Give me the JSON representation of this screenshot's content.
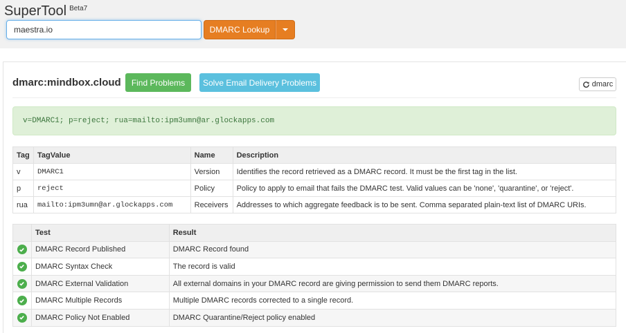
{
  "app": {
    "name": "SuperTool",
    "badge": "Beta7"
  },
  "search": {
    "value": "maestra.io",
    "lookup_label": "DMARC Lookup"
  },
  "result": {
    "title": "dmarc:mindbox.cloud",
    "find_problems_label": "Find Problems",
    "solve_label": "Solve Email Delivery Problems",
    "refresh_label": "dmarc",
    "record": "v=DMARC1; p=reject; rua=mailto:ipm3umn@ar.glockapps.com"
  },
  "tags_table": {
    "headers": [
      "Tag",
      "TagValue",
      "Name",
      "Description"
    ],
    "rows": [
      {
        "tag": "v",
        "value": "DMARC1",
        "name": "Version",
        "description": "Identifies the record retrieved as a DMARC record. It must be the first tag in the list."
      },
      {
        "tag": "p",
        "value": "reject",
        "name": "Policy",
        "description": "Policy to apply to email that fails the DMARC test. Valid values can be 'none', 'quarantine', or 'reject'."
      },
      {
        "tag": "rua",
        "value": "mailto:ipm3umn@ar.glockapps.com",
        "name": "Receivers",
        "description": "Addresses to which aggregate feedback is to be sent. Comma separated plain-text list of DMARC URIs."
      }
    ]
  },
  "tests_table": {
    "headers": [
      "",
      "Test",
      "Result"
    ],
    "rows": [
      {
        "status": "pass",
        "test": "DMARC Record Published",
        "result": "DMARC Record found"
      },
      {
        "status": "pass",
        "test": "DMARC Syntax Check",
        "result": "The record is valid"
      },
      {
        "status": "pass",
        "test": "DMARC External Validation",
        "result": "All external domains in your DMARC record are giving permission to send them DMARC reports."
      },
      {
        "status": "pass",
        "test": "DMARC Multiple Records",
        "result": "Multiple DMARC records corrected to a single record."
      },
      {
        "status": "pass",
        "test": "DMARC Policy Not Enabled",
        "result": "DMARC Quarantine/Reject policy enabled"
      }
    ]
  },
  "colors": {
    "primary_orange": "#e67e22",
    "success_green": "#5cb85c",
    "info_blue": "#5bc0de",
    "record_bg": "#dff0d8"
  },
  "icons": {
    "status_pass": "check-circle-icon",
    "refresh": "refresh-icon",
    "dropdown": "caret-down-icon"
  }
}
